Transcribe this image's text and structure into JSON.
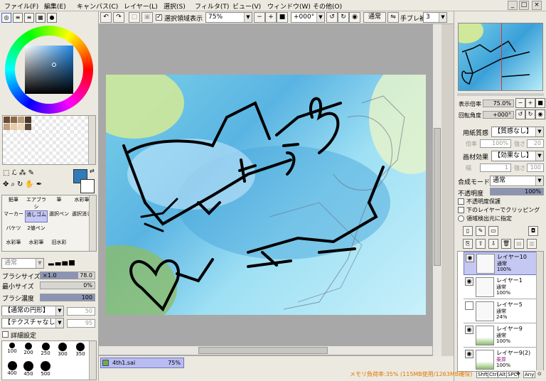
{
  "menu": {
    "items": [
      "ファイル(F)",
      "編集(E)",
      "キャンバス(C)",
      "レイヤー(L)",
      "選択(S)",
      "フィルタ(T)",
      "ビュー(V)",
      "ウィンドウ(W)",
      "その他(O)"
    ]
  },
  "window_buttons": [
    "_",
    "□",
    "×"
  ],
  "toolbar": {
    "selection_label": "選択領域表示",
    "zoom_value": "75%",
    "rotation_value": "+000°",
    "blend_value": "通常",
    "stabilizer_label": "手ブレ補正",
    "stabilizer_value": "3"
  },
  "colors": {
    "current": "#2f7cb8",
    "secondary": "#ffffff",
    "accent": "#8c94b4",
    "selected_layer": "#c4c8f2"
  },
  "swatches": [
    "#6b4a2e",
    "#8a6a4a",
    "#b89a7a",
    "#4a3424",
    "#c0a080",
    "#e8cba8",
    "#f0d8b8",
    "#5a4a3a"
  ],
  "tools": {
    "row1": [
      "鉛筆",
      "エアブラシ",
      "筆",
      "水彩筆"
    ],
    "row2": [
      "マーカー",
      "消しゴム",
      "選択ペン",
      "選択消し"
    ],
    "row3": [
      "バケツ",
      "2値ペン",
      "",
      ""
    ],
    "row4": [
      "水彩筆",
      "水彩筆",
      "旧水彩",
      ""
    ]
  },
  "brush": {
    "mode": "通常",
    "size_label": "ブラシサイズ",
    "size_multiplier": "×1.0",
    "size_value": "78.0",
    "min_size_label": "最小サイズ",
    "min_size_value": "0%",
    "density_label": "ブラシ濃度",
    "density_value": "100",
    "shape_value": "【通常の円形】",
    "shape_amount": "50",
    "texture_value": "【テクスチャなし】",
    "texture_amount": "95",
    "detail_label": "詳細設定",
    "sizes": [
      "100",
      "200",
      "250",
      "300",
      "350",
      "400",
      "450",
      "500"
    ]
  },
  "document_tab": {
    "name": "4th1.sai",
    "zoom": "75%"
  },
  "navigator": {
    "zoom_label": "表示倍率",
    "zoom_value": "75.0%",
    "angle_label": "回転角度",
    "angle_value": "+000°"
  },
  "paper": {
    "texture_label": "用紙質感",
    "texture_value": "【質感なし】",
    "scale_label": "倍率",
    "scale_value": "100%",
    "strength_label": "強さ",
    "strength_value": "20",
    "effect_label": "画材効果",
    "effect_value": "【効果なし】",
    "width_label": "幅",
    "width_value": "1",
    "intensity_label": "強さ",
    "intensity_value": "100"
  },
  "layer_props": {
    "blend_label": "合成モード",
    "blend_value": "通常",
    "opacity_label": "不透明度",
    "opacity_value": "100%",
    "opacity_level": 1.0,
    "protect_label": "不透明度保護",
    "clip_label": "下のレイヤーでクリッピング",
    "source_label": "領域検出元に指定"
  },
  "layers": [
    {
      "name": "レイヤー10",
      "mode": "通常",
      "opacity": "100%"
    },
    {
      "name": "レイヤー1",
      "mode": "通常",
      "opacity": "100%"
    },
    {
      "name": "レイヤー5",
      "mode": "通常",
      "opacity": "24%"
    },
    {
      "name": "レイヤー9",
      "mode": "通常",
      "opacity": "100%"
    },
    {
      "name": "レイヤー9(2)",
      "mode": "乗算",
      "opacity": "100%"
    }
  ],
  "status": {
    "memory": "メモリ負荷率:35% (115MB使用/1263MB確保)",
    "keys": [
      "Shft",
      "Ctrl",
      "Alt",
      "SPC",
      "Any"
    ]
  }
}
